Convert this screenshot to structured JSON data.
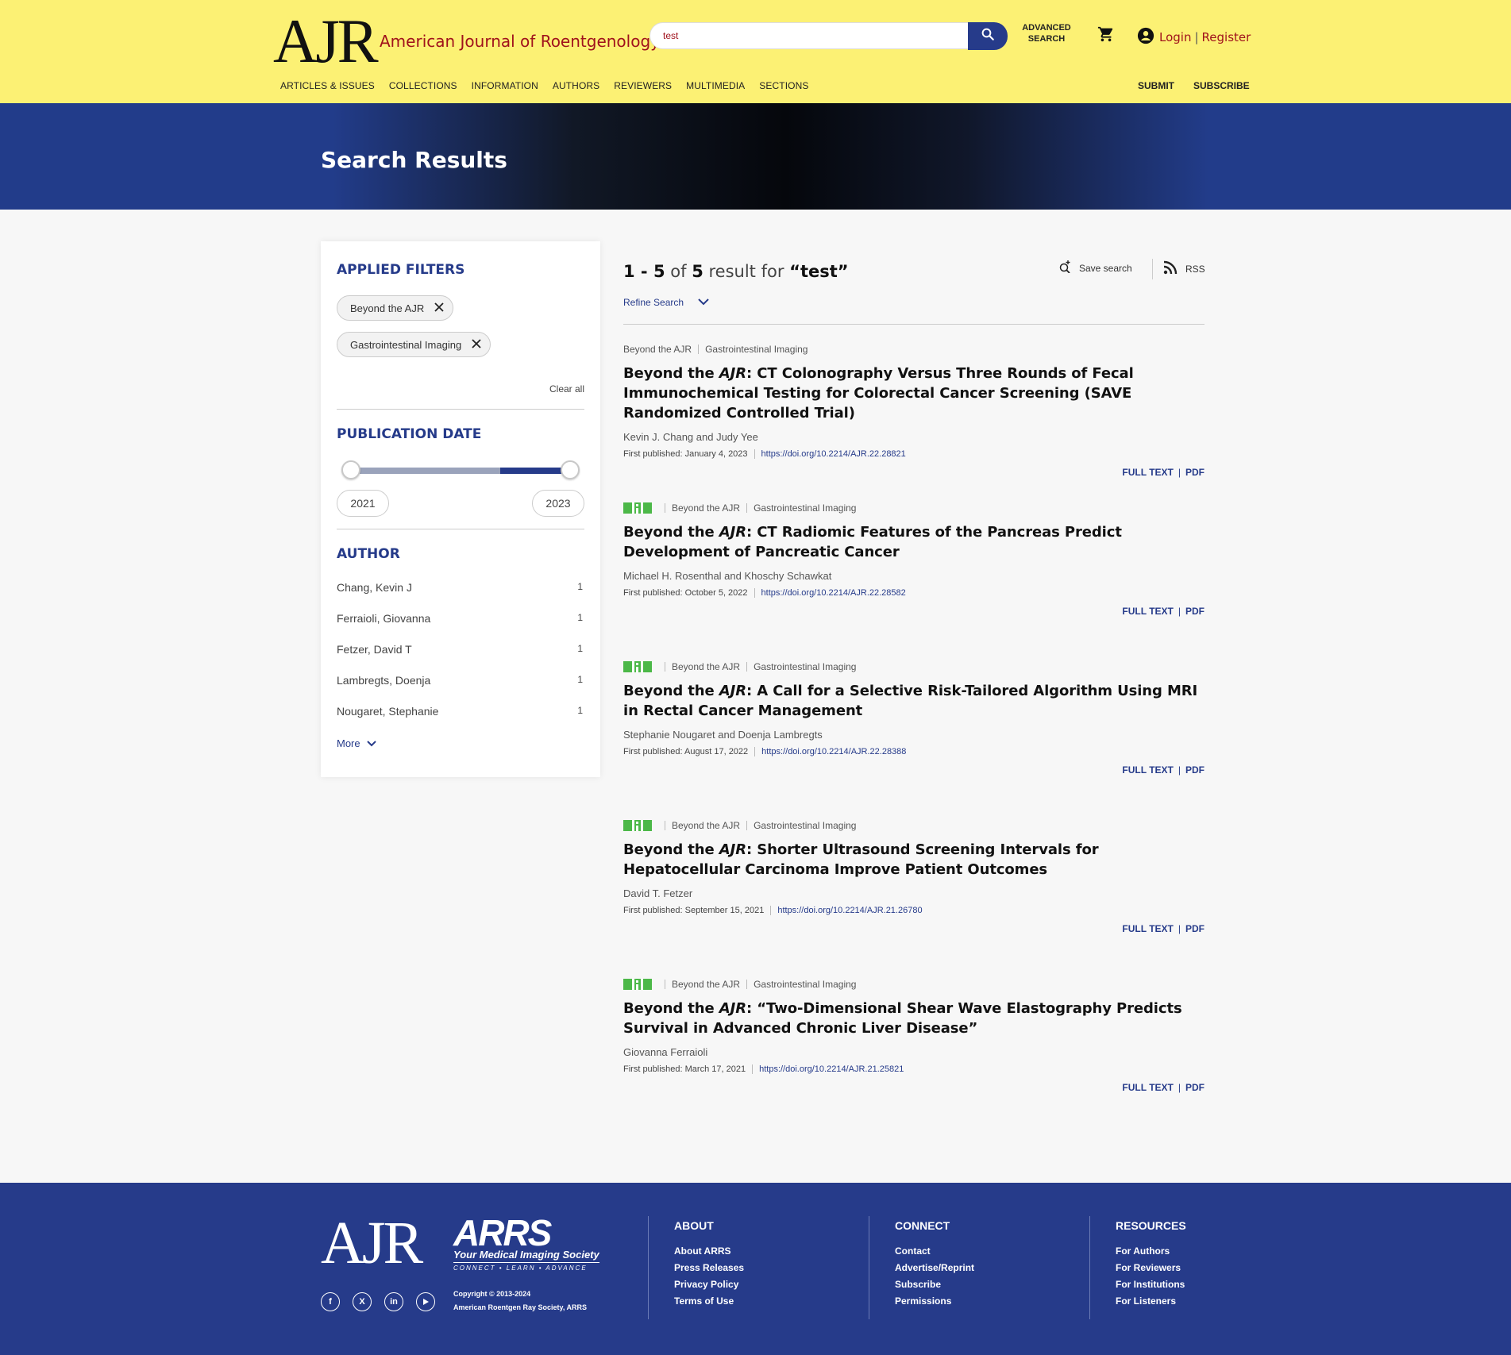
{
  "header": {
    "logo": "AJR",
    "journal_name": "American Journal of Roentgenology",
    "search_value": "test",
    "advanced_search": "ADVANCED SEARCH",
    "login": "Login",
    "register": "Register",
    "login_sep": "|",
    "nav": [
      "ARTICLES & ISSUES",
      "COLLECTIONS",
      "INFORMATION",
      "AUTHORS",
      "REVIEWERS",
      "MULTIMEDIA",
      "SECTIONS"
    ],
    "right_nav": [
      "SUBMIT",
      "SUBSCRIBE"
    ]
  },
  "banner": {
    "title": "Search Results"
  },
  "sidebar": {
    "applied_filters_heading": "APPLIED FILTERS",
    "filters": [
      "Beyond the AJR",
      "Gastrointestinal Imaging"
    ],
    "clear_all": "Clear all",
    "publication_date_heading": "PUBLICATION DATE",
    "date_range": {
      "min_year": "2021",
      "max_year": "2023",
      "fill_start_fraction": 0.68,
      "fill_end_fraction": 1.0
    },
    "author_heading": "AUTHOR",
    "authors": [
      {
        "name": "Chang, Kevin J",
        "count": "1"
      },
      {
        "name": "Ferraioli, Giovanna",
        "count": "1"
      },
      {
        "name": "Fetzer, David T",
        "count": "1"
      },
      {
        "name": "Lambregts, Doenja",
        "count": "1"
      },
      {
        "name": "Nougaret, Stephanie",
        "count": "1"
      }
    ],
    "more": "More"
  },
  "results_header": {
    "range": "1 - 5",
    "of": "of",
    "total": "5",
    "result_for": "result for",
    "query": "“test”",
    "save_search": "Save search",
    "rss": "RSS",
    "refine": "Refine Search"
  },
  "results": [
    {
      "open_access": false,
      "section": "Beyond the AJR",
      "subsection": "Gastrointestinal Imaging",
      "title_prefix": "Beyond the ",
      "title_italic": "AJR",
      "title_rest": ": CT Colonography Versus Three Rounds of Fecal Immunochemical Testing for Colorectal Cancer Screening (SAVE Randomized Controlled Trial)",
      "authors": "Kevin J. Chang and Judy Yee",
      "published": "First published: January 4, 2023",
      "doi": "https://doi.org/10.2214/AJR.22.28821",
      "full_text": "FULL TEXT",
      "pdf": "PDF"
    },
    {
      "open_access": true,
      "section": "Beyond the AJR",
      "subsection": "Gastrointestinal Imaging",
      "title_prefix": "Beyond the ",
      "title_italic": "AJR",
      "title_rest": ": CT Radiomic Features of the Pancreas Predict Development of Pancreatic Cancer",
      "authors": "Michael H. Rosenthal and Khoschy Schawkat",
      "published": "First published: October 5, 2022",
      "doi": "https://doi.org/10.2214/AJR.22.28582",
      "full_text": "FULL TEXT",
      "pdf": "PDF"
    },
    {
      "open_access": true,
      "section": "Beyond the AJR",
      "subsection": "Gastrointestinal Imaging",
      "title_prefix": "Beyond the ",
      "title_italic": "AJR",
      "title_rest": ": A Call for a Selective Risk-Tailored Algorithm Using MRI in Rectal Cancer Management",
      "authors": "Stephanie Nougaret and Doenja Lambregts",
      "published": "First published: August 17, 2022",
      "doi": "https://doi.org/10.2214/AJR.22.28388",
      "full_text": "FULL TEXT",
      "pdf": "PDF"
    },
    {
      "open_access": true,
      "section": "Beyond the AJR",
      "subsection": "Gastrointestinal Imaging",
      "title_prefix": "Beyond the ",
      "title_italic": "AJR",
      "title_rest": ": Shorter Ultrasound Screening Intervals for Hepatocellular Carcinoma Improve Patient Outcomes",
      "authors": "David T. Fetzer",
      "published": "First published: September 15, 2021",
      "doi": "https://doi.org/10.2214/AJR.21.26780",
      "full_text": "FULL TEXT",
      "pdf": "PDF"
    },
    {
      "open_access": true,
      "section": "Beyond the AJR",
      "subsection": "Gastrointestinal Imaging",
      "title_prefix": "Beyond the ",
      "title_italic": "AJR",
      "title_rest": ": “Two-Dimensional Shear Wave Elastography Predicts Survival in Advanced Chronic Liver Disease”",
      "authors": "Giovanna Ferraioli",
      "published": "First published: March 17, 2021",
      "doi": "https://doi.org/10.2214/AJR.21.25821",
      "full_text": "FULL TEXT",
      "pdf": "PDF"
    }
  ],
  "link_sep": "|",
  "footer": {
    "logo": "AJR",
    "arrs": "ARRS",
    "arrs_tagline": "Your Medical Imaging Society",
    "arrs_motto": "CONNECT • LEARN • ADVANCE",
    "copyright_line1": "Copyright © 2013-2024",
    "copyright_line2": "American Roentgen Ray Society, ARRS",
    "columns": [
      {
        "heading": "ABOUT",
        "links": [
          "About ARRS",
          "Press Releases",
          "Privacy Policy",
          "Terms of Use"
        ]
      },
      {
        "heading": "CONNECT",
        "links": [
          "Contact",
          "Advertise/Reprint",
          "Subscribe",
          "Permissions"
        ]
      },
      {
        "heading": "RESOURCES",
        "links": [
          "For Authors",
          "For Reviewers",
          "For Institutions",
          "For Listeners"
        ]
      }
    ]
  },
  "colors": {
    "brand_yellow": "#fcf174",
    "brand_blue": "#263b8a",
    "link_red": "#a0121c",
    "open_access_green": "#4cb848"
  },
  "icons": [
    "search-icon",
    "cart-icon",
    "user-icon",
    "close-icon",
    "chevron-down-icon",
    "save-search-icon",
    "rss-icon",
    "open-access-icon",
    "facebook-icon",
    "x-icon",
    "linkedin-icon",
    "youtube-icon"
  ]
}
